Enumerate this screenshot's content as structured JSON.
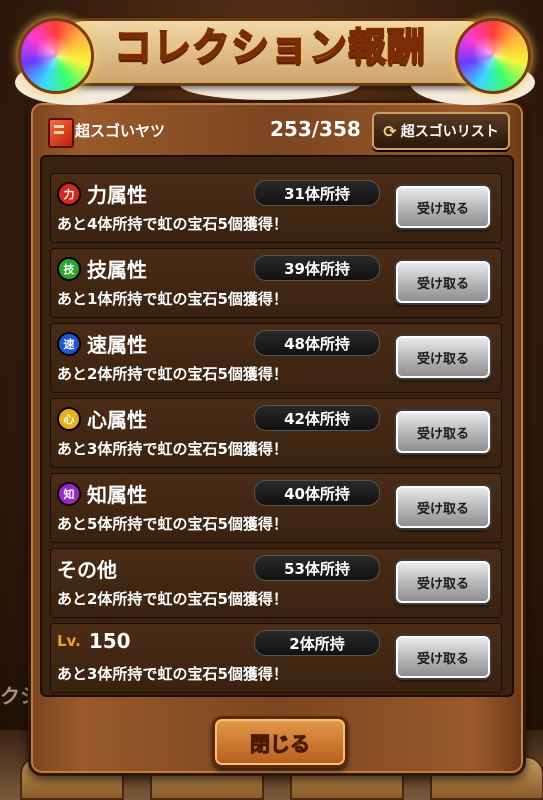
{
  "title": "コレクション報酬",
  "header": {
    "book_icon": "book-icon",
    "label": "超スゴいヤツ",
    "count": "253/358",
    "list_button": "超スゴいリスト",
    "list_icon": "refresh-icon"
  },
  "rows": [
    {
      "icon_text": "力",
      "icon_color": "#d8281e",
      "title": "力属性",
      "prefix": "",
      "count": "31体所持",
      "desc": "あと4体所持で虹の宝石5個獲得！",
      "button": "受け取る"
    },
    {
      "icon_text": "技",
      "icon_color": "#2aa82a",
      "title": "技属性",
      "prefix": "",
      "count": "39体所持",
      "desc": "あと1体所持で虹の宝石5個獲得！",
      "button": "受け取る"
    },
    {
      "icon_text": "速",
      "icon_color": "#1e56d8",
      "title": "速属性",
      "prefix": "",
      "count": "48体所持",
      "desc": "あと2体所持で虹の宝石5個獲得！",
      "button": "受け取る"
    },
    {
      "icon_text": "心",
      "icon_color": "#e8b014",
      "title": "心属性",
      "prefix": "",
      "count": "42体所持",
      "desc": "あと3体所持で虹の宝石5個獲得！",
      "button": "受け取る"
    },
    {
      "icon_text": "知",
      "icon_color": "#9a28c8",
      "title": "知属性",
      "prefix": "",
      "count": "40体所持",
      "desc": "あと5体所持で虹の宝石5個獲得！",
      "button": "受け取る"
    },
    {
      "icon_text": "",
      "icon_color": "",
      "title": "その他",
      "prefix": "",
      "count": "53体所持",
      "desc": "あと2体所持で虹の宝石5個獲得！",
      "button": "受け取る"
    },
    {
      "icon_text": "",
      "icon_color": "",
      "title": "150",
      "prefix": "Lv.",
      "count": "2体所持",
      "desc": "あと3体所持で虹の宝石5個獲得！",
      "button": "受け取る"
    }
  ],
  "close_button": "閉じる"
}
